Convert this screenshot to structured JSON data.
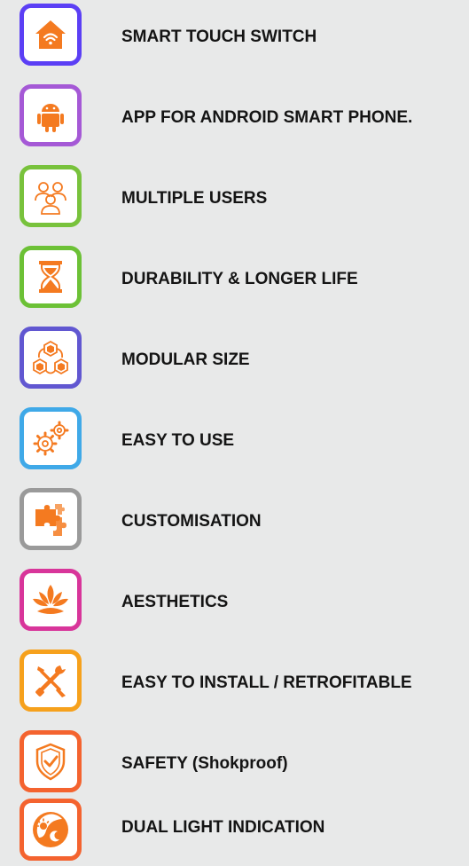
{
  "features": [
    {
      "label": "SMART TOUCH SWITCH",
      "icon": "smart-home-wifi-icon",
      "border_color": "#5b3ff5"
    },
    {
      "label": "APP FOR ANDROID SMART PHONE.",
      "icon": "android-icon",
      "border_color": "#a559d6"
    },
    {
      "label": "MULTIPLE USERS",
      "icon": "users-icon",
      "border_color": "#78c23c"
    },
    {
      "label": "DURABILITY & LONGER LIFE",
      "icon": "hourglass-icon",
      "border_color": "#6cc136"
    },
    {
      "label": "MODULAR SIZE",
      "icon": "modules-icon",
      "border_color": "#6157d1"
    },
    {
      "label": "EASY TO USE",
      "icon": "gears-icon",
      "border_color": "#3fa9e8"
    },
    {
      "label": "CUSTOMISATION",
      "icon": "puzzle-icon",
      "border_color": "#9a9a9a"
    },
    {
      "label": "AESTHETICS",
      "icon": "lotus-icon",
      "border_color": "#d8359a"
    },
    {
      "label": "EASY TO INSTALL / RETROFITABLE",
      "icon": "tools-icon",
      "border_color": "#f6a11c"
    },
    {
      "label": "SAFETY (Shokproof)",
      "icon": "shield-check-icon",
      "border_color": "#f4632f"
    },
    {
      "label": "DUAL LIGHT INDICATION",
      "icon": "sun-moon-icon",
      "border_color": "#f4632f"
    }
  ],
  "accent_color": "#f47a20"
}
